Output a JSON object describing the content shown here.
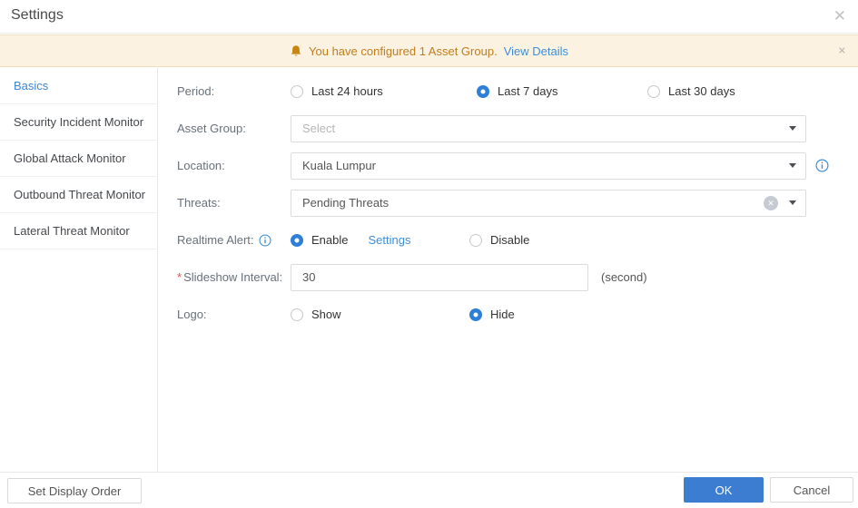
{
  "window": {
    "title": "Settings"
  },
  "icons": {
    "close": "✕",
    "banner_close": "✕",
    "clear": "✕"
  },
  "banner": {
    "text": "You have configured 1 Asset Group.",
    "link": "View Details"
  },
  "sidebar": {
    "items": [
      {
        "label": "Basics",
        "active": true
      },
      {
        "label": "Security Incident Monitor",
        "active": false
      },
      {
        "label": "Global Attack Monitor",
        "active": false
      },
      {
        "label": "Outbound Threat Monitor",
        "active": false
      },
      {
        "label": "Lateral Threat Monitor",
        "active": false
      }
    ]
  },
  "form": {
    "period": {
      "label": "Period:",
      "options": [
        {
          "label": "Last 24 hours",
          "selected": false
        },
        {
          "label": "Last 7 days",
          "selected": true
        },
        {
          "label": "Last 30 days",
          "selected": false
        }
      ]
    },
    "asset_group": {
      "label": "Asset Group:",
      "placeholder": "Select"
    },
    "location": {
      "label": "Location:",
      "value": "Kuala Lumpur"
    },
    "threats": {
      "label": "Threats:",
      "value": "Pending Threats"
    },
    "realtime_alert": {
      "label": "Realtime Alert:",
      "enable_label": "Enable",
      "enable_selected": true,
      "settings_link": "Settings",
      "disable_label": "Disable"
    },
    "slideshow_interval": {
      "required_mark": "*",
      "label": "Slideshow Interval:",
      "value": "30",
      "suffix": "(second)"
    },
    "logo": {
      "label": "Logo:",
      "show_label": "Show",
      "hide_label": "Hide",
      "hide_selected": true
    }
  },
  "footer": {
    "set_display_order": "Set Display Order",
    "ok": "OK",
    "cancel": "Cancel"
  },
  "colors": {
    "accent_blue": "#3d7dd1",
    "link_blue": "#3d8fd9",
    "radio_blue": "#2e7fd8",
    "banner_bg": "#fcf2e2",
    "banner_text": "#c07e1e",
    "bell_orange": "#c8860f",
    "required_red": "#e05252"
  }
}
